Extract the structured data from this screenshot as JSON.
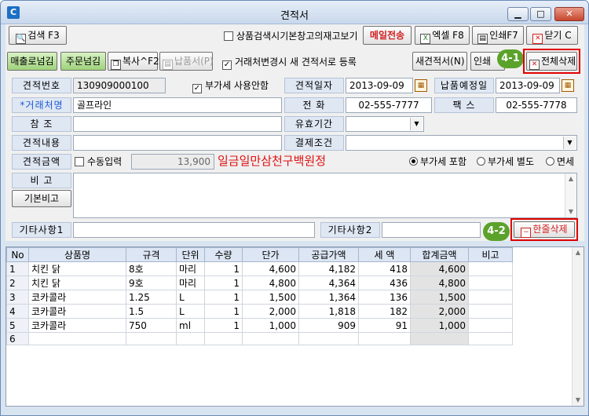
{
  "window": {
    "title": "견적서",
    "app_icon": "C"
  },
  "toolbar1": {
    "search": "검색 F3",
    "stock_check": "상품검색시기본창고의재고보기",
    "mail_send": "메일전송",
    "excel": "엑셀 F8",
    "print": "인쇄F7",
    "close": "닫기 C"
  },
  "toolbar2": {
    "sales_transfer": "매출로넘김",
    "order_transfer": "주문넘김",
    "copy": "복사^F2",
    "delivery": "납품서(P)",
    "new_quote_on_change": "거래처변경시 새 견적서로 등록",
    "new_quote": "새견적서(N)",
    "print": "인쇄",
    "delete_all": "전체삭제"
  },
  "annotations": {
    "badge1": "4-1",
    "badge2": "4-2"
  },
  "form": {
    "quote_no_label": "견적번호",
    "quote_no": "130909000100",
    "vat_unused": "부가세 사용안함",
    "quote_date_label": "견적일자",
    "quote_date": "2013-09-09",
    "delivery_date_label": "납품예정일",
    "delivery_date": "2013-09-09",
    "client_label": "*거래처명",
    "client": "골프라인",
    "phone_label": "전      화",
    "phone": "02-555-7777",
    "fax_label": "팩      스",
    "fax": "02-555-7778",
    "ref_label": "참      조",
    "validity_label": "유효기간",
    "content_label": "견적내용",
    "payment_label": "결제조건",
    "amount_label": "견적금액",
    "manual_input": "수동입력",
    "amount": "13,900",
    "amount_words": "일금일만삼천구백원정",
    "vat_include": "부가세 포함",
    "vat_separate": "부가세 별도",
    "tax_free": "면세",
    "note_label": "비      고",
    "basic_note": "기본비고",
    "etc1_label": "기타사항1",
    "etc2_label": "기타사항2",
    "delete_row": "한줄삭제"
  },
  "grid": {
    "headers": [
      "No",
      "상품명",
      "규격",
      "단위",
      "수량",
      "단가",
      "공급가액",
      "세 액",
      "합계금액",
      "비고"
    ],
    "rows": [
      [
        "1",
        "치킨 닭",
        "8호",
        "마리",
        "1",
        "4,600",
        "4,182",
        "418",
        "4,600",
        ""
      ],
      [
        "2",
        "치킨 닭",
        "9호",
        "마리",
        "1",
        "4,800",
        "4,364",
        "436",
        "4,800",
        ""
      ],
      [
        "3",
        "코카콜라",
        "1.25",
        "L",
        "1",
        "1,500",
        "1,364",
        "136",
        "1,500",
        ""
      ],
      [
        "4",
        "코카콜라",
        "1.5",
        "L",
        "1",
        "2,000",
        "1,818",
        "182",
        "2,000",
        ""
      ],
      [
        "5",
        "코카콜라",
        "750",
        "ml",
        "1",
        "1,000",
        "909",
        "91",
        "1,000",
        ""
      ],
      [
        "6",
        "",
        "",
        "",
        "",
        "",
        "",
        "",
        "",
        ""
      ]
    ]
  }
}
